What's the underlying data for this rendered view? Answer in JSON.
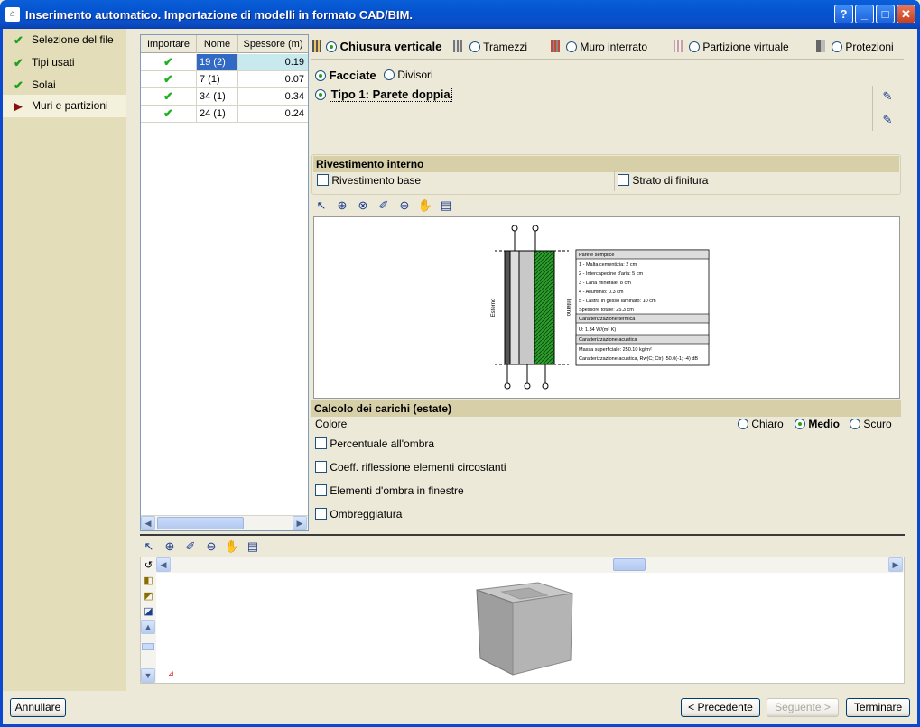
{
  "window": {
    "title": "Inserimento automatico. Importazione di modelli in formato CAD/BIM."
  },
  "sidebar": {
    "items": [
      {
        "label": "Selezione del file",
        "state": "done"
      },
      {
        "label": "Tipi usati",
        "state": "done"
      },
      {
        "label": "Solai",
        "state": "done"
      },
      {
        "label": "Muri e partizioni",
        "state": "current"
      }
    ]
  },
  "table": {
    "headers": [
      "Importare",
      "Nome",
      "Spessore (m)"
    ],
    "rows": [
      {
        "nome": "19 (2)",
        "spessore": "0.19"
      },
      {
        "nome": "7 (1)",
        "spessore": "0.07"
      },
      {
        "nome": "34 (1)",
        "spessore": "0.34"
      },
      {
        "nome": "24 (1)",
        "spessore": "0.24"
      }
    ]
  },
  "wall_types": {
    "options": [
      "Chiusura verticale",
      "Tramezzi",
      "Muro interrato",
      "Partizione virtuale",
      "Protezioni"
    ],
    "selected": "Chiusura verticale"
  },
  "subtypes": {
    "options": [
      "Facciate",
      "Divisori"
    ],
    "selected": "Facciate"
  },
  "type_item": {
    "label": "Tipo 1: Parete doppia"
  },
  "rivestimento": {
    "title": "Rivestimento interno",
    "options": [
      "Rivestimento base",
      "Strato di finitura"
    ]
  },
  "drawing": {
    "left_label": "Esterno",
    "right_label": "Interno",
    "legend": {
      "title": "Parete semplice",
      "layers": [
        "1 - Malta cementizia: 2 cm",
        "2 - Intercapedine d'aria: 5 cm",
        "3 - Lana minerale: 8 cm",
        "4 - Alluminio: 0.3 cm",
        "5 - Lastra in gesso laminato: 10 cm",
        "Spessore totale: 25.3 cm"
      ],
      "thermal_title": "Caratterizzazione termica",
      "thermal_value": "U: 1.34 W/(m² K)",
      "acoustic_title": "Caratterizzazione acustica",
      "acoustic_lines": [
        "Massa superficiale: 250.10 kg/m²",
        "Caratterizzazione acustica, Rw(C; Ctr): 50.0(-1; -4) dB"
      ]
    }
  },
  "carichi": {
    "title": "Calcolo dei carichi (estate)",
    "colore_label": "Colore",
    "colore_options": [
      "Chiaro",
      "Medio",
      "Scuro"
    ],
    "colore_selected": "Medio",
    "checkboxes": [
      "Percentuale all'ombra",
      "Coeff. riflessione elementi circostanti",
      "Elementi d'ombra in finestre",
      "Ombreggiatura"
    ]
  },
  "buttons": {
    "cancel": "Annullare",
    "prev": "< Precedente",
    "next": "Seguente >",
    "finish": "Terminare"
  }
}
